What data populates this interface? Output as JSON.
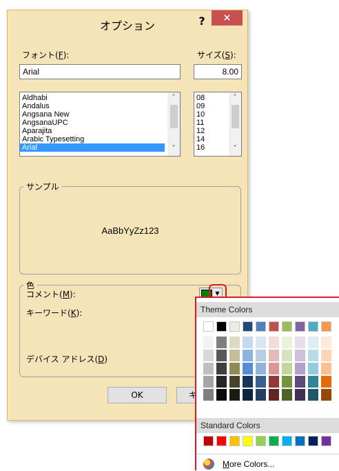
{
  "dialog": {
    "title": "オプション",
    "help_label": "?",
    "close_label": "×",
    "font_label_prefix": "フォント(",
    "font_label_key": "F",
    "font_label_suffix": "):",
    "size_label_prefix": "サイズ(",
    "size_label_key": "S",
    "size_label_suffix": "):",
    "font_value": "Arial",
    "size_value": "8.00",
    "font_list": [
      "Aldhabi",
      "Andalus",
      "Angsana New",
      "AngsanaUPC",
      "Aparajita",
      "Arabic Typesetting",
      "Arial"
    ],
    "font_selected_index": 6,
    "size_list": [
      "08",
      "09",
      "10",
      "11",
      "12",
      "14",
      "16"
    ],
    "sample_group_label": "サンプル",
    "sample_text": "AaBbYyZz123",
    "color_group_label": "色",
    "comment_label_prefix": "コメント(",
    "comment_label_key": "M",
    "comment_label_suffix": "):",
    "keyword_label_prefix": "キーワード(",
    "keyword_label_key": "K",
    "keyword_label_suffix": "):",
    "address_label_prefix": "デバイス アドレス(",
    "address_label_key": "D",
    "address_label_suffix": ")",
    "ok_label": "OK",
    "cancel_label": "キャ",
    "comment_color": "#008000"
  },
  "palette": {
    "theme_header": "Theme Colors",
    "standard_header": "Standard Colors",
    "more_colors_label": "More Colors...",
    "more_colors_key": "M",
    "theme_top": [
      "#ffffff",
      "#000000",
      "#eeece1",
      "#1f497d",
      "#4f81bd",
      "#c0504d",
      "#9bbb59",
      "#8064a2",
      "#4bacc6",
      "#f79646"
    ],
    "theme_columns": [
      [
        "#f2f2f2",
        "#d8d8d8",
        "#bfbfbf",
        "#a5a5a5",
        "#7f7f7f"
      ],
      [
        "#7f7f7f",
        "#595959",
        "#3f3f3f",
        "#262626",
        "#0c0c0c"
      ],
      [
        "#ddd9c3",
        "#c4bd97",
        "#938953",
        "#494429",
        "#1d1b10"
      ],
      [
        "#c6d9f0",
        "#8db3e2",
        "#548dd4",
        "#17365d",
        "#0f243e"
      ],
      [
        "#dbe5f1",
        "#b8cce4",
        "#95b3d7",
        "#366092",
        "#244061"
      ],
      [
        "#f2dcdb",
        "#e5b9b7",
        "#d99694",
        "#953734",
        "#632423"
      ],
      [
        "#ebf1dd",
        "#d7e3bc",
        "#c3d69b",
        "#76923c",
        "#4f6128"
      ],
      [
        "#e5e0ec",
        "#ccc1d9",
        "#b2a2c7",
        "#5f497a",
        "#3f3151"
      ],
      [
        "#dbeef3",
        "#b7dde8",
        "#92cddc",
        "#31859b",
        "#205867"
      ],
      [
        "#fdeada",
        "#fbd5b5",
        "#fac08f",
        "#e36c09",
        "#974806"
      ]
    ],
    "standard_colors": [
      "#c00000",
      "#ff0000",
      "#ffc000",
      "#ffff00",
      "#92d050",
      "#00b050",
      "#00b0f0",
      "#0070c0",
      "#002060",
      "#7030a0"
    ]
  }
}
